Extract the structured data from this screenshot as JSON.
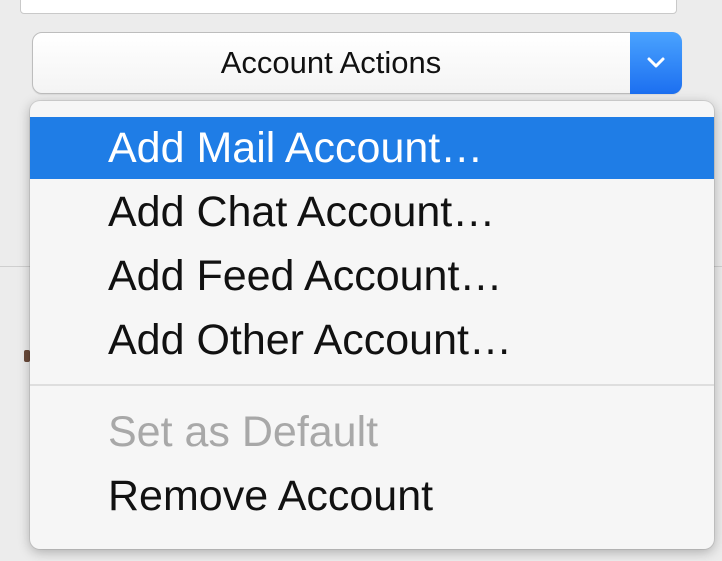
{
  "popup": {
    "label": "Account Actions",
    "arrow_icon": "chevron-down-icon",
    "accent_color": "#1f7de6"
  },
  "menu": {
    "items": [
      {
        "label": "Add Mail Account…",
        "state": "highlighted"
      },
      {
        "label": "Add Chat Account…",
        "state": "enabled"
      },
      {
        "label": "Add Feed Account…",
        "state": "enabled"
      },
      {
        "label": "Add Other Account…",
        "state": "enabled"
      }
    ],
    "secondary_items": [
      {
        "label": "Set as Default",
        "state": "disabled"
      },
      {
        "label": "Remove Account",
        "state": "enabled"
      }
    ]
  }
}
